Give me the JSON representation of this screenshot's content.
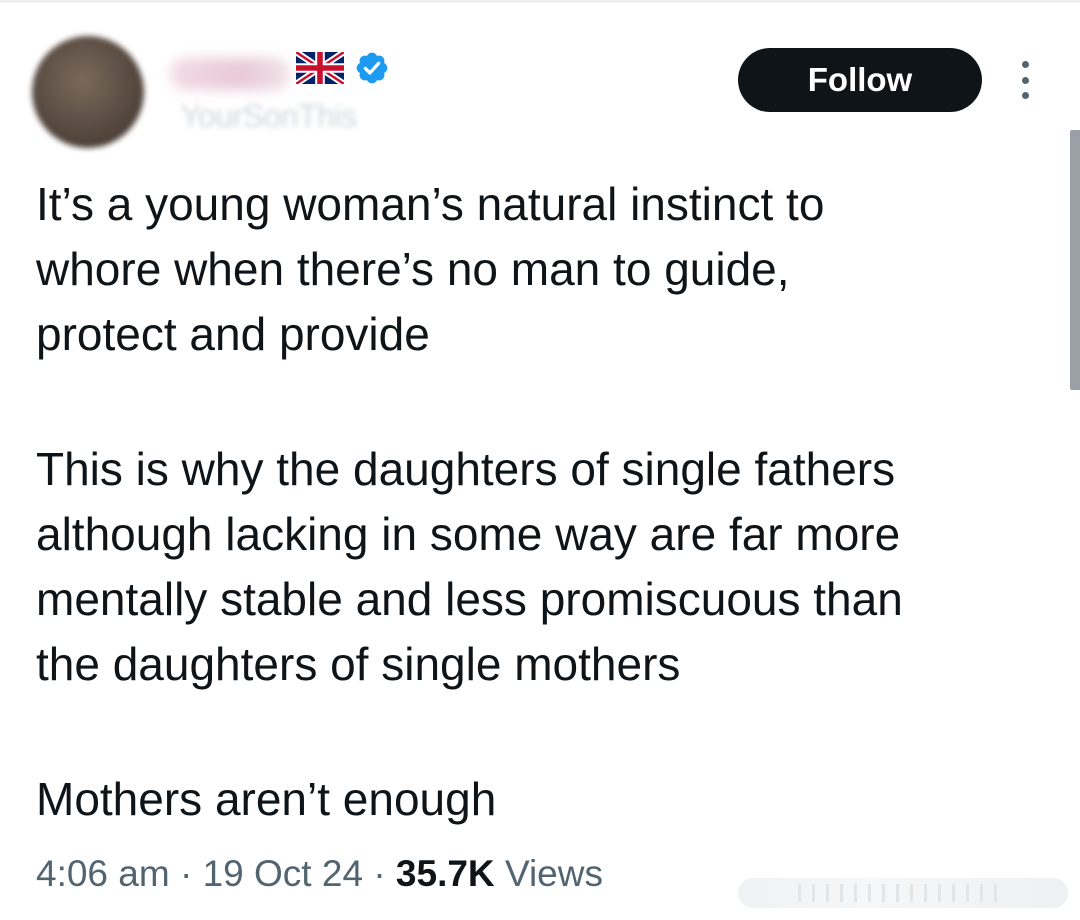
{
  "author": {
    "handle": "YourSonThis",
    "flag_icon": "uk-flag-icon",
    "verified_icon": "verified-badge-icon",
    "verified_color": "#1d9bf0"
  },
  "actions": {
    "follow_label": "Follow",
    "more_icon": "more-vertical-icon"
  },
  "tweet": {
    "paragraphs": [
      "It’s a young woman’s natural instinct to\nwhore when there’s no man to guide,\nprotect and provide",
      "This is why the daughters of single fathers\nalthough lacking in some way are far more\nmentally stable and less promiscuous than\nthe daughters of single mothers",
      "Mothers aren’t enough"
    ]
  },
  "meta": {
    "time": "4:06 am",
    "separator": "·",
    "date": "19 Oct 24",
    "views_count": "35.7K",
    "views_label": "Views"
  },
  "colors": {
    "text": "#0f1419",
    "secondary_text": "#536471",
    "follow_button_bg": "#0f1419",
    "follow_button_text": "#ffffff"
  }
}
